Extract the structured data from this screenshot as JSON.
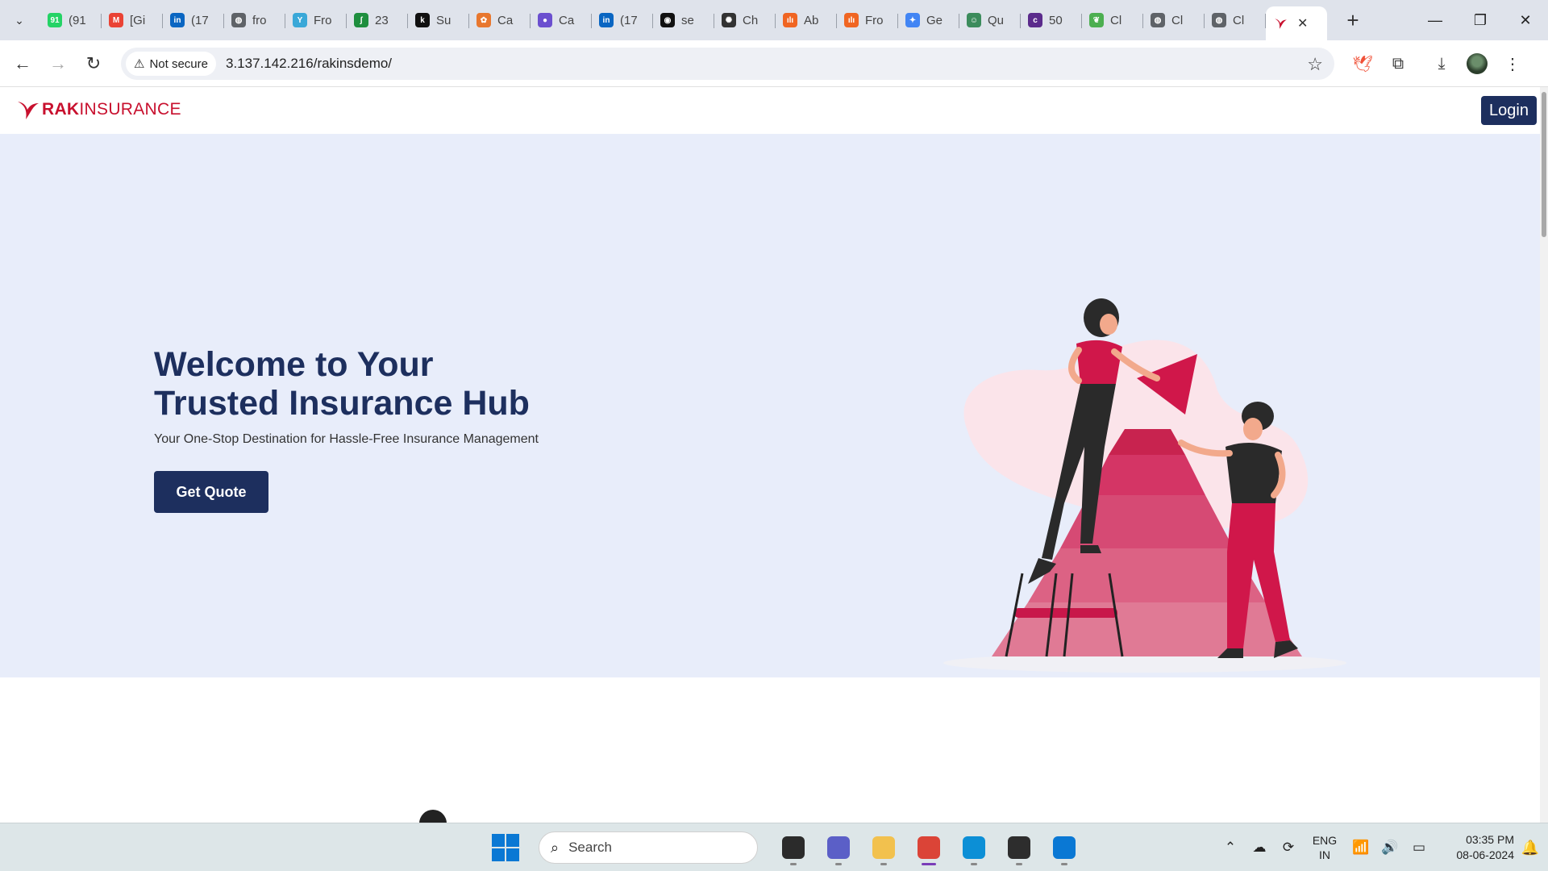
{
  "browser": {
    "tabs": [
      {
        "title": "(91",
        "icon": "whatsapp-icon",
        "color": "#25d366",
        "glyph": "91"
      },
      {
        "title": "[Gi",
        "icon": "gmail-icon",
        "color": "#ea4335",
        "glyph": "M"
      },
      {
        "title": "(17",
        "icon": "linkedin-icon",
        "color": "#0a66c2",
        "glyph": "in"
      },
      {
        "title": "fro",
        "icon": "globe-icon",
        "color": "#5f6368",
        "glyph": "◍"
      },
      {
        "title": "Fro",
        "icon": "y-icon",
        "color": "#3aa8d8",
        "glyph": "Y"
      },
      {
        "title": "23",
        "icon": "sheets-icon",
        "color": "#1e8e3e",
        "glyph": "ʃ"
      },
      {
        "title": "Su",
        "icon": "k-icon",
        "color": "#111111",
        "glyph": "k"
      },
      {
        "title": "Ca",
        "icon": "canva-icon",
        "color": "#e8772e",
        "glyph": "✿"
      },
      {
        "title": "Ca",
        "icon": "user-circle-icon",
        "color": "#6b4fcf",
        "glyph": "●"
      },
      {
        "title": "(17",
        "icon": "linkedin-icon",
        "color": "#0a66c2",
        "glyph": "in"
      },
      {
        "title": "se",
        "icon": "github-icon",
        "color": "#111111",
        "glyph": "◉"
      },
      {
        "title": "Ch",
        "icon": "openai-icon",
        "color": "#333333",
        "glyph": "✺"
      },
      {
        "title": "Ab",
        "icon": "chart-icon",
        "color": "#f06522",
        "glyph": "ılı"
      },
      {
        "title": "Fro",
        "icon": "chart-icon",
        "color": "#f06522",
        "glyph": "ılı"
      },
      {
        "title": "Ge",
        "icon": "gemini-icon",
        "color": "#4285f4",
        "glyph": "✦"
      },
      {
        "title": "Qu",
        "icon": "bot-icon",
        "color": "#3c8c5c",
        "glyph": "☺"
      },
      {
        "title": "50",
        "icon": "colorlib-icon",
        "color": "#5b2b8c",
        "glyph": "c"
      },
      {
        "title": "Cl",
        "icon": "leaf-icon",
        "color": "#4caf50",
        "glyph": "❦"
      },
      {
        "title": "Cl",
        "icon": "globe-icon",
        "color": "#5f6368",
        "glyph": "◍"
      },
      {
        "title": "Cl",
        "icon": "globe-icon",
        "color": "#5f6368",
        "glyph": "◍"
      }
    ],
    "active_tab": {
      "icon": "rak-logo-icon",
      "color": "#c8102e"
    },
    "security_label": "Not secure",
    "url": "3.137.142.216/rakinsdemo/"
  },
  "site": {
    "logo_rak": "RAK",
    "logo_insurance": "INSURANCE",
    "login_label": "Login",
    "hero_title_line1": "Welcome to Your",
    "hero_title_line2": "Trusted Insurance Hub",
    "hero_subtitle": "Your One-Stop Destination for Hassle-Free Insurance Management",
    "cta_label": "Get Quote",
    "colors": {
      "primary": "#1d2f5e",
      "brand_red": "#c8102e",
      "hero_bg": "#e8edfa"
    }
  },
  "taskbar": {
    "search_placeholder": "Search",
    "apps": [
      {
        "name": "file-explorer-dark-icon",
        "color": "#2b2b2b"
      },
      {
        "name": "teams-icon",
        "color": "#5b5fc7"
      },
      {
        "name": "folder-icon",
        "color": "#f2c14e"
      },
      {
        "name": "chrome-icon",
        "color": "#db4437",
        "active": true
      },
      {
        "name": "edge-icon",
        "color": "#0c8fd6"
      },
      {
        "name": "terminal-icon",
        "color": "#2d2d2d"
      },
      {
        "name": "vscode-icon",
        "color": "#0a78d4"
      }
    ],
    "lang_line1": "ENG",
    "lang_line2": "IN",
    "time": "03:35 PM",
    "date": "08-06-2024"
  }
}
